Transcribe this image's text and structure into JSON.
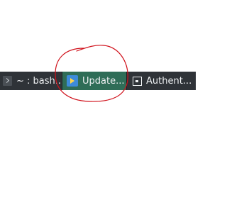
{
  "taskbar": {
    "background": "#2f3338",
    "active_color": "#2f6d57",
    "tasks": [
      {
        "label": "~ : bash...",
        "icon": "terminal-icon"
      },
      {
        "label": "Update...",
        "icon": "software-update-icon",
        "active": true
      },
      {
        "label": "Authent...",
        "icon": "lock-icon"
      }
    ]
  },
  "annotation": {
    "shape": "hand-drawn circle",
    "color": "#d0101a"
  }
}
